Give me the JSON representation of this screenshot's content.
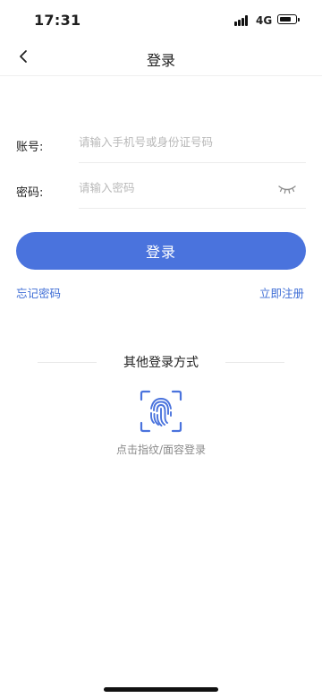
{
  "status_bar": {
    "time": "17:31",
    "network": "4G",
    "icons": [
      "signal-icon",
      "battery-icon"
    ]
  },
  "nav": {
    "title": "登录",
    "back_icon": "chevron-left-icon"
  },
  "form": {
    "account": {
      "label": "账号:",
      "placeholder": "请输入手机号或身份证号码",
      "value": ""
    },
    "password": {
      "label": "密码:",
      "placeholder": "请输入密码",
      "value": "",
      "toggle_icon": "eye-closed-icon"
    }
  },
  "login_button": "登录",
  "links": {
    "forgot": "忘记密码",
    "register": "立即注册"
  },
  "other_login": {
    "title": "其他登录方式",
    "icon": "fingerprint-icon",
    "hint": "点击指纹/面容登录"
  },
  "colors": {
    "accent": "#4a73dd",
    "link": "#3f6ed6",
    "placeholder": "#b9b9b9",
    "hint": "#8a8a8a"
  }
}
